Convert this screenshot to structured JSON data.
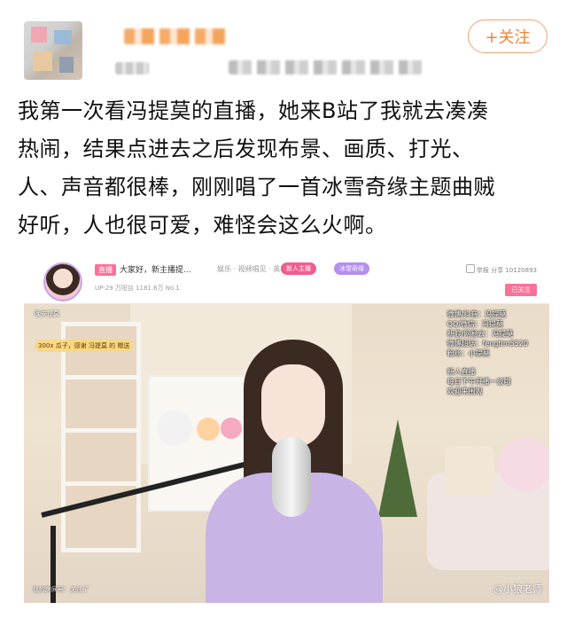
{
  "post": {
    "follow_label": "+关注",
    "text_lines": [
      "我第一次看冯提莫的直播，她来B站了我就去凑凑",
      "热闹，结果点进去之后发现布景、画质、打光、",
      "人、声音都很棒，刚刚唱了一首冰雪奇缘主题曲贼",
      "好听，人也很可爱，难怪会这么火啊。"
    ]
  },
  "stream": {
    "live_badge": "直播",
    "room_title": "大家好，新主播提...",
    "category": "娱乐 · 视频唱见 · 英雄联盟",
    "pill_a": "新人主播",
    "pill_b": "冰雪奇缘",
    "stats": "UP-29  万阳台  1181.6万  No.1",
    "rank": "No.1",
    "top_right": "举报  分享  10120893",
    "follow_mini": "已关注",
    "gift_banner": "300x 瓜子，感谢 冯提莫 的 赠送",
    "info_lines": [
      "微博/抖音：冯提莫",
      "QQ/微信：冯提莫",
      "新浪/网易云：冯提莫",
      "微博超话：fengtim5520",
      "粉丝：小提莫"
    ],
    "notice_lines": [
      "新人直播",
      "每日下午开播一波哦",
      "欢迎来围观"
    ],
    "corner_tag": "晚安提莫",
    "bottom_note": "我的房间号：关注了",
    "watermark": "@小狼老师"
  }
}
